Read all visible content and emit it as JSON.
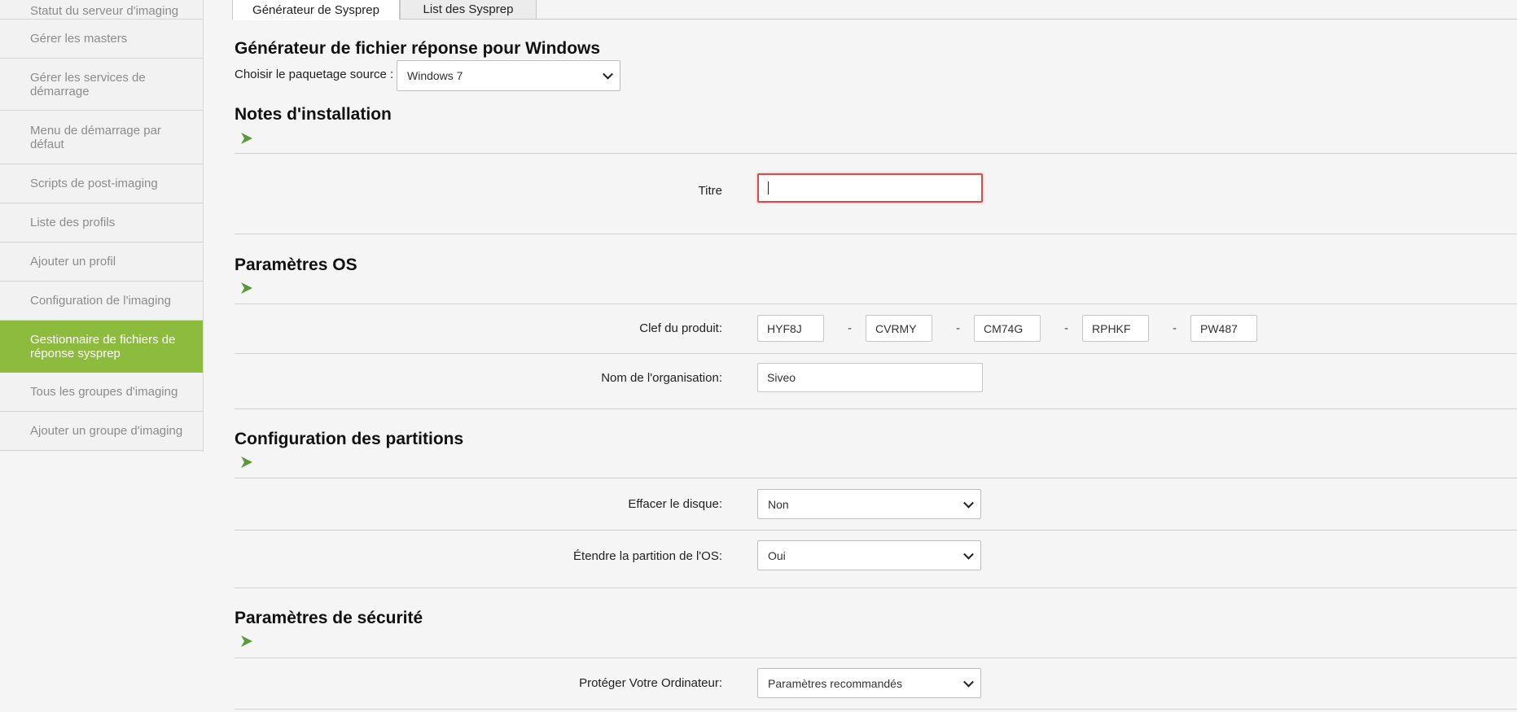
{
  "sidebar": {
    "items": [
      {
        "label": "Statut du serveur d'imaging"
      },
      {
        "label": "Gérer les masters"
      },
      {
        "label": "Gérer les services de démarrage"
      },
      {
        "label": "Menu de démarrage par défaut"
      },
      {
        "label": "Scripts de post-imaging"
      },
      {
        "label": "Liste des profils"
      },
      {
        "label": "Ajouter un profil"
      },
      {
        "label": "Configuration de l'imaging"
      },
      {
        "label": "Gestionnaire de fichiers de réponse sysprep"
      },
      {
        "label": "Tous les groupes d'imaging"
      },
      {
        "label": "Ajouter un groupe d'imaging"
      }
    ],
    "active_color": "#8cbb3e"
  },
  "tabs": [
    {
      "label": "Générateur de Sysprep"
    },
    {
      "label": "List des Sysprep"
    }
  ],
  "main": {
    "title": "Générateur de fichier réponse pour Windows",
    "source_label": "Choisir le paquetage source :",
    "source_value": "Windows 7"
  },
  "sections": {
    "notes": {
      "title": "Notes d'installation",
      "titre_label": "Titre",
      "titre_value": ""
    },
    "os": {
      "title": "Paramètres OS",
      "product_key_label": "Clef du produit:",
      "product_key": [
        "HYF8J",
        "CVRMY",
        "CM74G",
        "RPHKF",
        "PW487"
      ],
      "separator": "-",
      "org_label": "Nom de l'organisation:",
      "org_value": "Siveo"
    },
    "partitions": {
      "title": "Configuration des partitions",
      "erase_label": "Effacer le disque:",
      "erase_value": "Non",
      "extend_label": "Étendre la partition de l'OS:",
      "extend_value": "Oui"
    },
    "security": {
      "title": "Paramètres de sécurité",
      "protect_label": "Protéger Votre Ordinateur:",
      "protect_value": "Paramètres recommandés"
    }
  },
  "icons": {
    "section_toggle": "chevron-right-icon",
    "dropdown": "chevron-down-icon"
  },
  "colors": {
    "accent": "#8cbb3e",
    "arrow": "#5a9a3a",
    "focus_border": "#e04848"
  }
}
